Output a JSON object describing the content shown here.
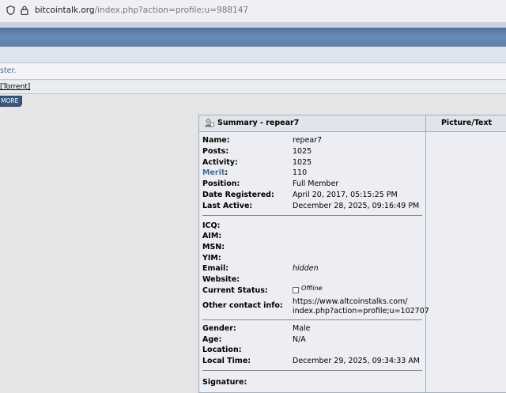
{
  "browser": {
    "url_host": "bitcointalk.org",
    "url_path": "/index.php?action=profile;u=988147"
  },
  "header": {
    "user_line_fragment": "ster.",
    "nav_torrent": "[Torrent]",
    "tab_label": "MORE"
  },
  "profile": {
    "summary_title": "Summary - repear7",
    "picture_title": "Picture/Text",
    "name_label": "Name:",
    "name": "repear7",
    "posts_label": "Posts:",
    "posts": "1025",
    "activity_label": "Activity:",
    "activity": "1025",
    "merit_label": "Merit",
    "merit_colon": ":",
    "merit": "110",
    "position_label": "Position:",
    "position": "Full Member",
    "registered_label": "Date Registered:",
    "registered": "April 20, 2017, 05:15:25 PM",
    "last_active_label": "Last Active:",
    "last_active": "December 28, 2025, 09:16:49 PM",
    "icq_label": "ICQ:",
    "aim_label": "AIM:",
    "msn_label": "MSN:",
    "yim_label": "YIM:",
    "email_label": "Email:",
    "email": "hidden",
    "website_label": "Website:",
    "status_label": "Current Status:",
    "status": "Offline",
    "contact_label": "Other contact info:",
    "contact_line1": "https://www.altcoinstalks.com/",
    "contact_line2": "index.php?action=profile;u=102707",
    "gender_label": "Gender:",
    "gender": "Male",
    "age_label": "Age:",
    "age": "N/A",
    "location_label": "Location:",
    "local_time_label": "Local Time:",
    "local_time": "December 29, 2025, 09:34:33 AM",
    "signature_label": "Signature:"
  },
  "icons": {
    "shield": "shield-icon",
    "lock": "lock-icon",
    "summary": "user-profile-icon",
    "status": "offline-status-icon"
  },
  "colors": {
    "header_blue": "#5a7ea8",
    "link_blue": "#476c8e",
    "panel_bg": "#eceef3"
  }
}
